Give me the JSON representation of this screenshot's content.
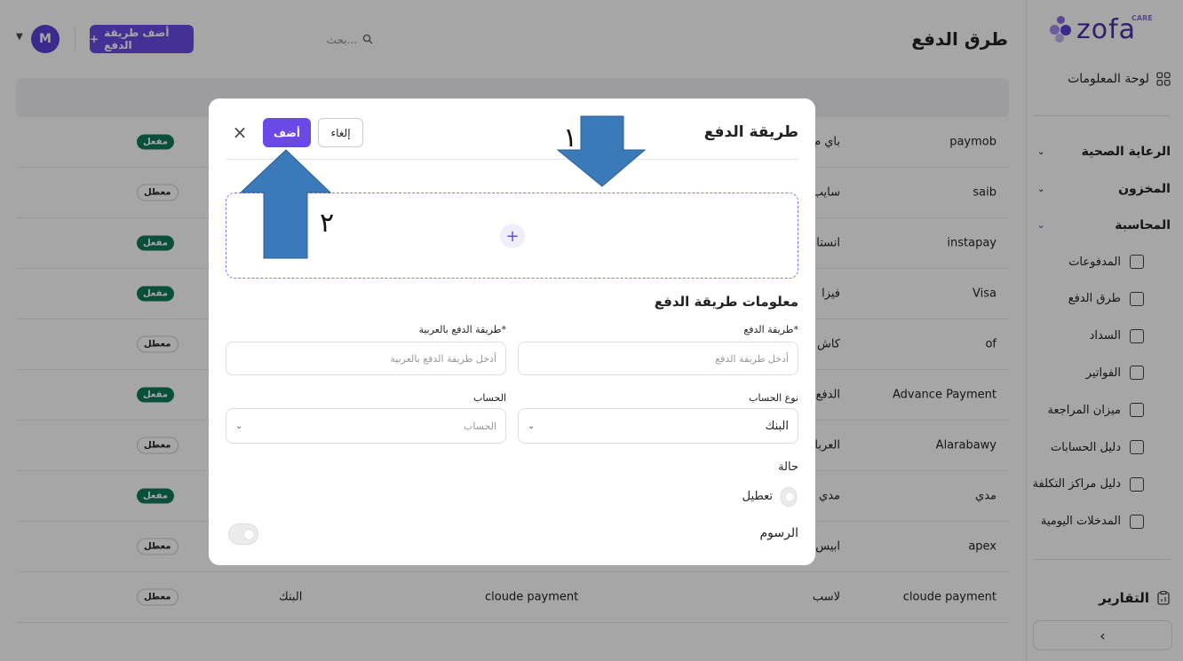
{
  "sidebar": {
    "logo_text": "zofa",
    "logo_badge": "CARE",
    "dashboard": "لوحة المعلومات",
    "groups": [
      {
        "label": "الرعاية الصحية"
      },
      {
        "label": "المخزون"
      },
      {
        "label": "المحاسبة"
      }
    ],
    "accounting_items": [
      {
        "label": "المدفوعات",
        "icon": "wallet-icon"
      },
      {
        "label": "طرق الدفع",
        "icon": "wallet-icon"
      },
      {
        "label": "السداد",
        "icon": "receipt-icon"
      },
      {
        "label": "الفواتير",
        "icon": "invoice-icon"
      },
      {
        "label": "ميزان المراجعة",
        "icon": "balance-icon"
      },
      {
        "label": "دليل الحسابات",
        "icon": "pie-chart-icon"
      },
      {
        "label": "دليل مراكز التكلفة",
        "icon": "chart-icon"
      },
      {
        "label": "المدخلات اليومية",
        "icon": "clipboard-icon"
      }
    ],
    "reports": "التقارير",
    "collapse_icon": "‹"
  },
  "header": {
    "title": "طرق الدفع",
    "search_placeholder": "بحث...",
    "add_button": "أضف طريقة الدفع",
    "avatar_initial": "M"
  },
  "table": {
    "rows": [
      {
        "name": "paymob",
        "name_ar": "باي م",
        "method": "",
        "account": "",
        "status": "مفعل",
        "active": true
      },
      {
        "name": "saib",
        "name_ar": "سايب",
        "method": "",
        "account": "",
        "status": "معطل",
        "active": false
      },
      {
        "name": "instapay",
        "name_ar": "انستاب",
        "method": "",
        "account": "",
        "status": "مفعل",
        "active": true
      },
      {
        "name": "Visa",
        "name_ar": "فيزا",
        "method": "",
        "account": "",
        "status": "مفعل",
        "active": true
      },
      {
        "name": "of",
        "name_ar": "كاش",
        "method": "",
        "account": "",
        "status": "معطل",
        "active": false
      },
      {
        "name": "Advance Payment",
        "name_ar": "الدفع",
        "method": "",
        "account": "",
        "status": "مفعل",
        "active": true
      },
      {
        "name": "Alarabawy",
        "name_ar": "العربا",
        "method": "",
        "account": "",
        "status": "معطل",
        "active": false
      },
      {
        "name": "مدي",
        "name_ar": "مدي",
        "method": "",
        "account": "",
        "status": "مفعل",
        "active": true
      },
      {
        "name": "apex",
        "name_ar": "ابيس",
        "method": "",
        "account": "",
        "status": "معطل",
        "active": false
      },
      {
        "name": "cloude payment",
        "name_ar": "لاسب",
        "method": "cloude payment",
        "account": "البنك",
        "status": "معطل",
        "active": false
      }
    ]
  },
  "modal": {
    "title": "طريقة الدفع",
    "add_label": "أضف",
    "cancel_label": "إلغاء",
    "close_icon": "×",
    "upload_icon": "+",
    "section_title": "معلومات طريقة الدفع",
    "method_label": "طريقة الدفع*",
    "method_placeholder": "أدخل طريقة الدفع",
    "method_ar_label": "طريقة الدفع بالعربية*",
    "method_ar_placeholder": "أدخل طريقة الدفع بالعربية",
    "account_type_label": "نوع الحساب",
    "account_type_value": "البنك",
    "account_label": "الحساب",
    "account_placeholder": "الحساب",
    "status_label": "حالة",
    "status_value": "تعطيل",
    "fees_label": "الرسوم"
  },
  "annotations": {
    "arrow1_number": "١",
    "arrow2_number": "٢",
    "arrow_color": "#3a7ab8"
  }
}
